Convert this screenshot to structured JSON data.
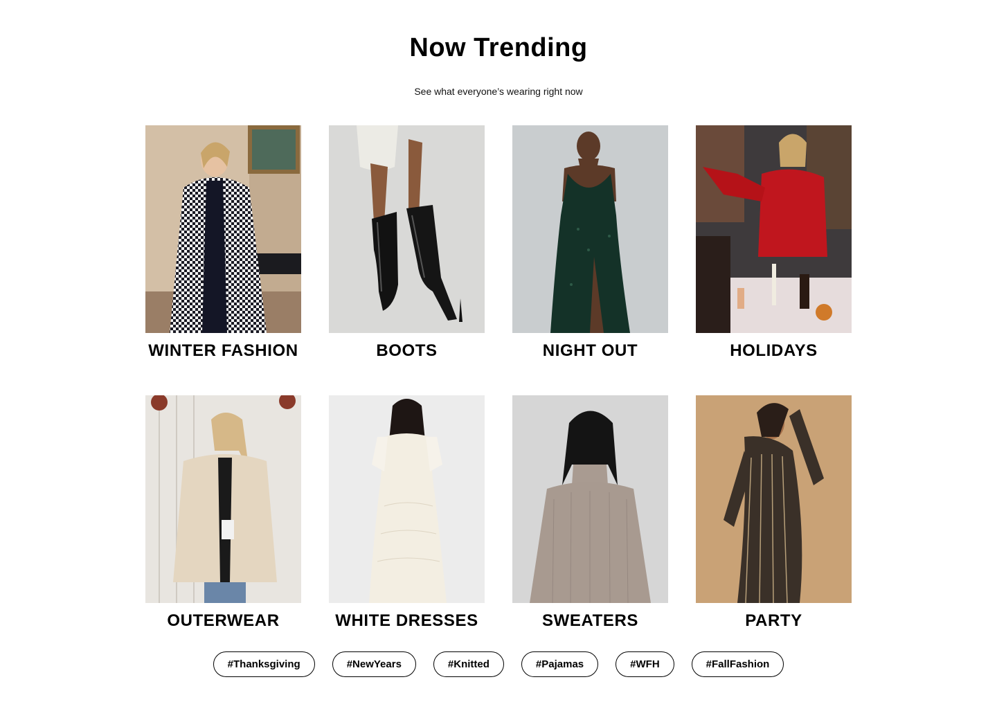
{
  "header": {
    "title": "Now Trending",
    "subtitle": "See what everyone’s wearing right now"
  },
  "categories": [
    {
      "label": "WINTER FASHION",
      "image": "woman-houndstooth-coat-photo",
      "bg": "#c9b49a",
      "accent": "#1c1c2a"
    },
    {
      "label": "BOOTS",
      "image": "black-knee-high-boots-photo",
      "bg": "#d8d8d6",
      "accent": "#141414"
    },
    {
      "label": "NIGHT OUT",
      "image": "green-sequin-gown-photo",
      "bg": "#c8ccce",
      "accent": "#143228"
    },
    {
      "label": "HOLIDAYS",
      "image": "red-blouse-holiday-party-photo",
      "bg": "#5a5048",
      "accent": "#c0161e"
    },
    {
      "label": "OUTERWEAR",
      "image": "cream-shacket-photo",
      "bg": "#e6e2dc",
      "accent": "#e4d6c0"
    },
    {
      "label": "WHITE DRESSES",
      "image": "white-lace-dress-photo",
      "bg": "#ececec",
      "accent": "#f3eee2"
    },
    {
      "label": "SWEATERS",
      "image": "grey-turtleneck-sweater-photo",
      "bg": "#d4d4d4",
      "accent": "#a89a90"
    },
    {
      "label": "PARTY",
      "image": "gold-sequin-dress-photo",
      "bg": "#c9a276",
      "accent": "#3a3028"
    }
  ],
  "tags": [
    "#Thanksgiving",
    "#NewYears",
    "#Knitted",
    "#Pajamas",
    "#WFH",
    "#FallFashion"
  ]
}
